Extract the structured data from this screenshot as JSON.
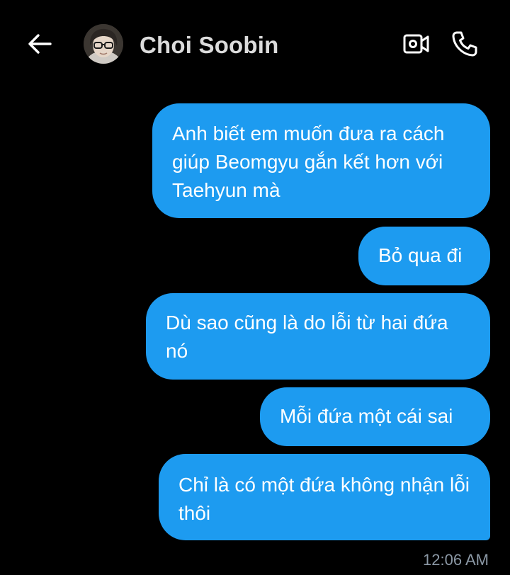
{
  "header": {
    "back_icon": "arrow-left-icon",
    "contact_name": "Choi Soobin",
    "video_icon": "video-camera-icon",
    "call_icon": "phone-icon"
  },
  "messages": [
    {
      "text": "Anh biết em muốn đưa ra cách giúp Beomgyu gắn kết hơn với Taehyun mà"
    },
    {
      "text": "Bỏ qua đi"
    },
    {
      "text": "Dù sao cũng là do lỗi từ hai đứa nó"
    },
    {
      "text": "Mỗi đứa một cái sai"
    },
    {
      "text": "Chỉ là có một đứa không nhận lỗi thôi"
    }
  ],
  "timestamp": "12:06 AM",
  "colors": {
    "background": "#000000",
    "bubble": "#1d9bf0",
    "bubble_text": "#ffffff",
    "timestamp": "#8b98a5"
  }
}
